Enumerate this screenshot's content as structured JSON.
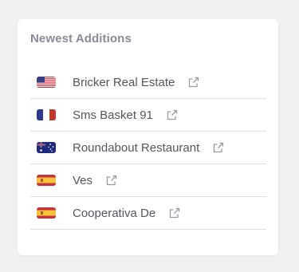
{
  "card": {
    "title": "Newest Additions"
  },
  "items": [
    {
      "name": "Bricker Real Estate",
      "flag": "us-flag-icon"
    },
    {
      "name": "Sms Basket 91",
      "flag": "fr-flag-icon"
    },
    {
      "name": "Roundabout Restaurant",
      "flag": "au-flag-icon"
    },
    {
      "name": "Ves",
      "flag": "es-flag-icon"
    },
    {
      "name": "Cooperativa De",
      "flag": "es-flag-icon"
    }
  ],
  "colors": {
    "title": "#8a8a9a",
    "text": "#555561",
    "divider": "#dedee2",
    "icon": "#9a9aa6"
  }
}
